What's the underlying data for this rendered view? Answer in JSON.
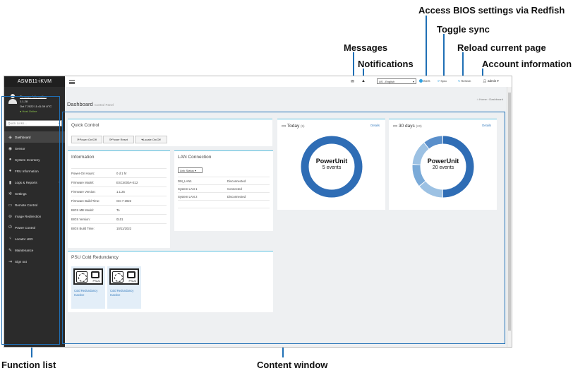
{
  "callouts": {
    "bios": "Access BIOS settings via Redfish",
    "sync": "Toggle sync",
    "messages": "Messages",
    "reload": "Reload current page",
    "notifications": "Notifications",
    "account": "Account information",
    "function_list": "Function list",
    "content_window": "Content window"
  },
  "sidebar": {
    "brand": "ASMB11-iKVM",
    "firmware_label": "Firmware Information",
    "firmware_version": "1.1.28",
    "firmware_date": "Oct 7 2022 11:41:39 UTC",
    "host_status": "Host Online",
    "quick_links_placeholder": "Quick Links...",
    "items": [
      {
        "label": "Dashboard",
        "icon": "dashboard-icon"
      },
      {
        "label": "Sensor",
        "icon": "sensor-icon"
      },
      {
        "label": "System Inventory",
        "icon": "inventory-icon"
      },
      {
        "label": "FRU Information",
        "icon": "info-icon"
      },
      {
        "label": "Logs & Reports",
        "icon": "chart-icon"
      },
      {
        "label": "Settings",
        "icon": "gear-icon"
      },
      {
        "label": "Remote Control",
        "icon": "monitor-icon"
      },
      {
        "label": "Image Redirection",
        "icon": "image-icon"
      },
      {
        "label": "Power Control",
        "icon": "power-icon"
      },
      {
        "label": "Locator LED",
        "icon": "bulb-icon"
      },
      {
        "label": "Maintenance",
        "icon": "wrench-icon"
      },
      {
        "label": "Sign out",
        "icon": "signout-icon"
      }
    ]
  },
  "topbar": {
    "language": "US - English",
    "bios_label": "BIOS",
    "sync_label": "Sync",
    "refresh_label": "Refresh",
    "account_label": "admin"
  },
  "page": {
    "title": "Dashboard",
    "subtitle": "Control Panel",
    "crumb_home": "Home",
    "crumb_current": "Dashboard"
  },
  "quick_control": {
    "title": "Quick Control",
    "buttons": [
      "Power On/Off",
      "Power Reset",
      "Locate On/Off"
    ]
  },
  "information": {
    "title": "Information",
    "rows": [
      {
        "key": "Power-On Hours:",
        "value": "0 d 1 hr"
      },
      {
        "key": "Firmware Model:",
        "value": "ESC4000A-E12"
      },
      {
        "key": "Firmware Version:",
        "value": "1.1.25"
      },
      {
        "key": "Firmware Build Time:",
        "value": "Oct 7 2022"
      },
      {
        "key": "BIOS MB Model:",
        "value": "To"
      },
      {
        "key": "BIOS Version:",
        "value": "0101"
      },
      {
        "key": "BIOS Build Time:",
        "value": "10/11/2022"
      }
    ]
  },
  "lan": {
    "title": "LAN Connection",
    "select": "Link Status",
    "rows": [
      {
        "key": "DM_LAN1",
        "value": "Disconnected"
      },
      {
        "key": "System LAN 1",
        "value": "Connected"
      },
      {
        "key": "System LAN 2",
        "value": "Disconnected"
      }
    ]
  },
  "psu": {
    "title": "PSU Cold Redundancy",
    "units": [
      {
        "label": "PSU1",
        "status_line1": "Cold Redundancy",
        "status_line2": "Inactive"
      },
      {
        "label": "PSU2",
        "status_line1": "Cold Redundancy",
        "status_line2": "Inactive"
      }
    ]
  },
  "today": {
    "title": "Today",
    "count": "(5)",
    "details": "Details",
    "center_title": "PowerUnit",
    "center_sub": "5 events"
  },
  "month": {
    "title": "30 days",
    "count": "(20)",
    "details": "Details",
    "center_title": "PowerUnit",
    "center_sub": "20 events"
  },
  "colors": {
    "accent": "#1f6fb5",
    "donut_main": "#2f6db5",
    "donut_light": "#9cc1e3"
  }
}
